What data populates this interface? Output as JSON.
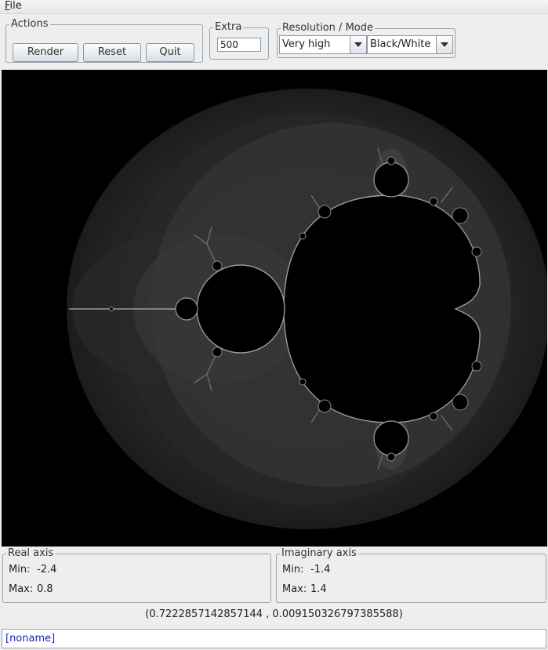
{
  "menu": {
    "file_label": "File",
    "file_mnemonic": "F",
    "file_rest": "ile"
  },
  "actions": {
    "title": "Actions",
    "render_label": "Render",
    "reset_label": "Reset",
    "quit_label": "Quit"
  },
  "extra": {
    "title": "Extra",
    "value": "500"
  },
  "resolution": {
    "title": "Resolution / Mode",
    "resolution_value": "Very high",
    "mode_value": "Black/White"
  },
  "real_axis": {
    "title": "Real axis",
    "min_label": "Min:",
    "min_value": "-2.4",
    "max_label": "Max:",
    "max_value": "0.8"
  },
  "imag_axis": {
    "title": "Imaginary axis",
    "min_label": "Min:",
    "min_value": "-1.4",
    "max_label": "Max:",
    "max_value": "1.4"
  },
  "coordinates": "(0.7222857142857144 , 0.009150326797385588)",
  "status": "[noname]",
  "colors": {
    "canvas_bg": "#000000",
    "status_text": "#1a25b0"
  },
  "icons": {
    "combo_arrow": "triangle-down-icon"
  }
}
